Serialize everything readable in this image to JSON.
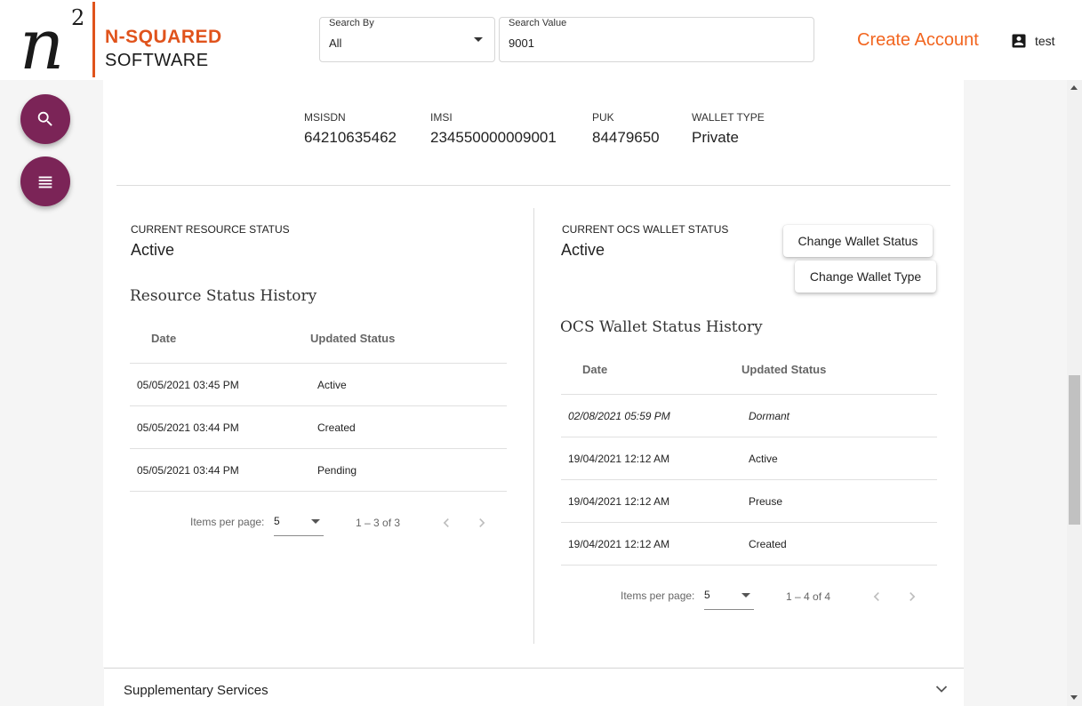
{
  "brand": {
    "line1": "N-SQUARED",
    "line2": "SOFTWARE",
    "accent": "#e0531c"
  },
  "search": {
    "by_label": "Search By",
    "by_value": "All",
    "value_label": "Search Value",
    "value": "9001"
  },
  "header": {
    "create_account": "Create Account",
    "username": "test"
  },
  "fabs": {
    "search_icon": "search-icon",
    "menu_icon": "list-icon",
    "color": "#7b2457"
  },
  "subscriber": {
    "msisdn_label": "MSISDN",
    "msisdn": "64210635462",
    "imsi_label": "IMSI",
    "imsi": "234550000009001",
    "puk_label": "PUK",
    "puk": "84479650",
    "wallet_type_label": "WALLET TYPE",
    "wallet_type": "Private"
  },
  "resource": {
    "status_label": "CURRENT RESOURCE STATUS",
    "status": "Active",
    "history_title": "Resource Status History",
    "col_date": "Date",
    "col_status": "Updated Status",
    "rows": [
      {
        "date": "05/05/2021 03:45 PM",
        "status": "Active"
      },
      {
        "date": "05/05/2021 03:44 PM",
        "status": "Created"
      },
      {
        "date": "05/05/2021 03:44 PM",
        "status": "Pending"
      }
    ],
    "items_per_page_label": "Items per page:",
    "items_per_page": "5",
    "range": "1 – 3 of 3"
  },
  "wallet": {
    "status_label": "CURRENT OCS WALLET STATUS",
    "status": "Active",
    "change_status_btn": "Change Wallet Status",
    "change_type_btn": "Change Wallet Type",
    "history_title": "OCS Wallet Status History",
    "col_date": "Date",
    "col_status": "Updated Status",
    "rows": [
      {
        "date": "02/08/2021 05:59 PM",
        "status": "Dormant"
      },
      {
        "date": "19/04/2021 12:12 AM",
        "status": "Active"
      },
      {
        "date": "19/04/2021 12:12 AM",
        "status": "Preuse"
      },
      {
        "date": "19/04/2021 12:12 AM",
        "status": "Created"
      }
    ],
    "items_per_page_label": "Items per page:",
    "items_per_page": "5",
    "range": "1 – 4 of 4"
  },
  "supplementary": {
    "title": "Supplementary Services"
  }
}
